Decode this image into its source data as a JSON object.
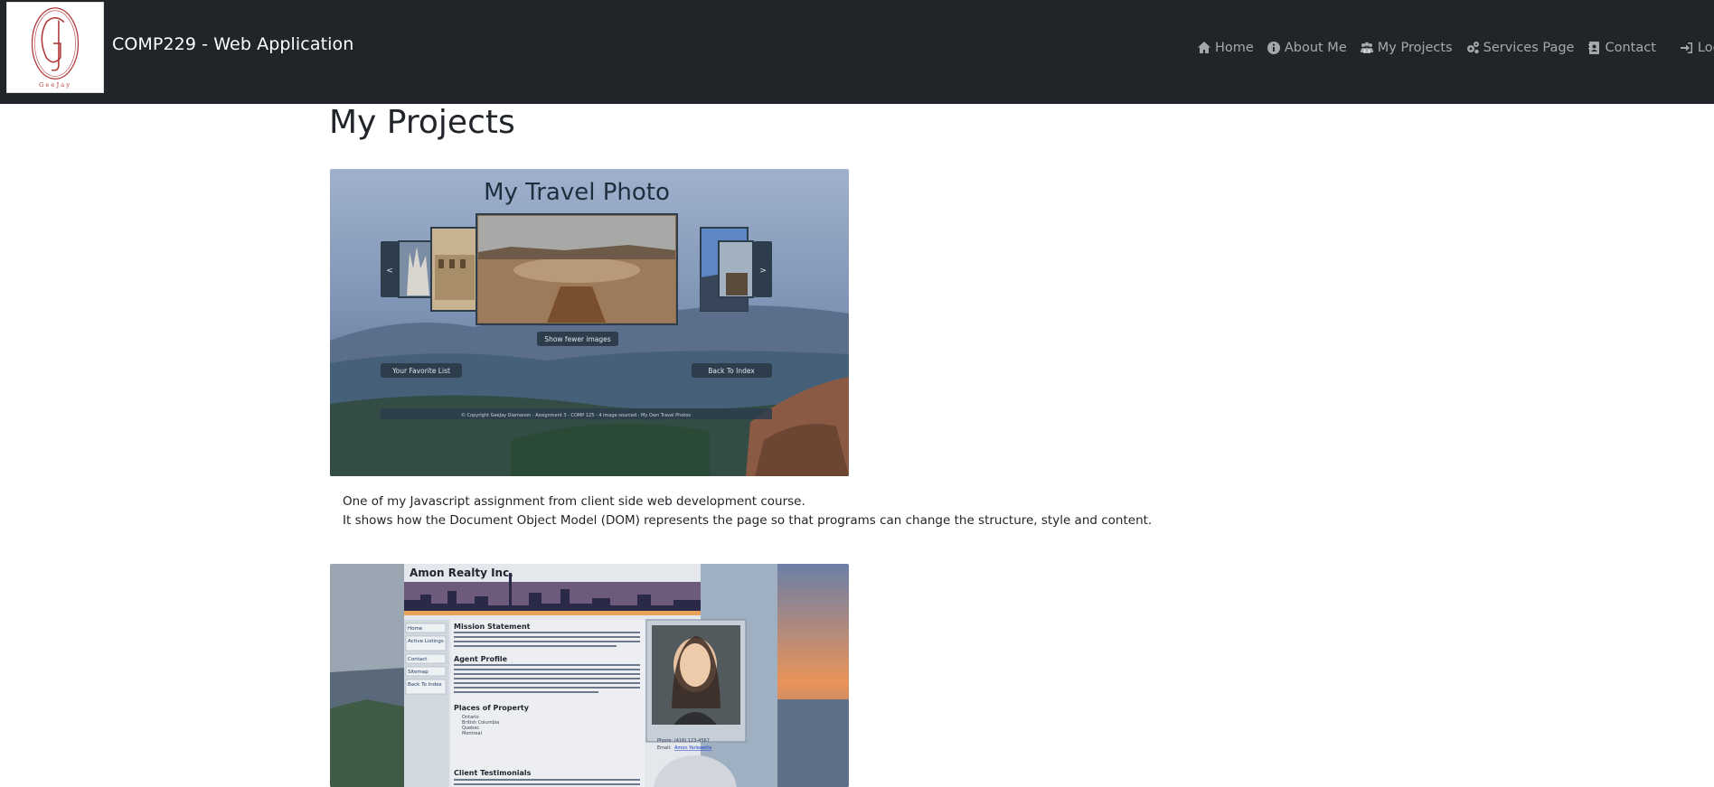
{
  "navbar": {
    "logo_text": "GeeJay",
    "brand": "COMP229 - Web Application",
    "items": [
      {
        "label": "Home",
        "icon": "home-icon"
      },
      {
        "label": "About Me",
        "icon": "info-circle-icon"
      },
      {
        "label": "My Projects",
        "icon": "projects-icon"
      },
      {
        "label": "Services Page",
        "icon": "cogs-icon"
      },
      {
        "label": "Contact",
        "icon": "contact-book-icon"
      }
    ],
    "login": {
      "label": "Log In",
      "icon": "sign-in-icon"
    }
  },
  "main": {
    "title": "My Projects",
    "projects": [
      {
        "screenshot": {
          "title": "My Travel Photo",
          "prev": "<",
          "next": ">",
          "toggle_button": "Show fewer images",
          "left_button": "Your Favorite List",
          "right_button": "Back To Index",
          "footer": "© Copyright GeeJay Diamanon - Assignment 3 - COMP 125 - 4 image sourced - My Own Travel Photos"
        },
        "description": [
          "One of my Javascript assignment from client side web development course.",
          "It shows how the Document Object Model (DOM) represents the page so that programs can change the structure, style and content."
        ]
      },
      {
        "screenshot": {
          "company": "Amon Realty Inc.",
          "menu": [
            "Home",
            "Active Listings",
            "Contact",
            "Sitemap",
            "Back To Index"
          ],
          "sections": [
            "Mission Statement",
            "Agent Profile",
            "Places of Property",
            "Client Testimonials"
          ],
          "mission_text": "To produce unconventional contribution with a dynamic retailing and referral business for leisure listings, the Amon Realty was modeled to be the first class individualistic real estate organization to the most distinguished customers. A leader in real estate franchising and contributor to real estate brokerage, rearrangement, and accommodation services.",
          "agent_text": "I arrived in Canada almost 30 years ago when my parents decided to migrate. I fell in love with the country and the people. I graduated with a degree in Marketing and started as a realtor 15 yrs ago. Business is slow at the start, and my first big break came when I unknowingly became the realtor of the Marketing VP of the top 22 company in Canada at that time. Nowadays, 75 percent of my new clients are referrals and living in their own home. As Marketing VP of prestigious Amon Realty, I can make your dream home come true.",
          "places": [
            "Ontario",
            "British Columbia",
            "Quebec",
            "Montreal"
          ],
          "testimonial": "Ron and Claudia: We used Amon Realty to look for a property with a stunning view",
          "phone": "Phone: (416) 123-4567",
          "email_label": "Email:",
          "email_link": "Amon Yarleaetta"
        }
      }
    ]
  }
}
